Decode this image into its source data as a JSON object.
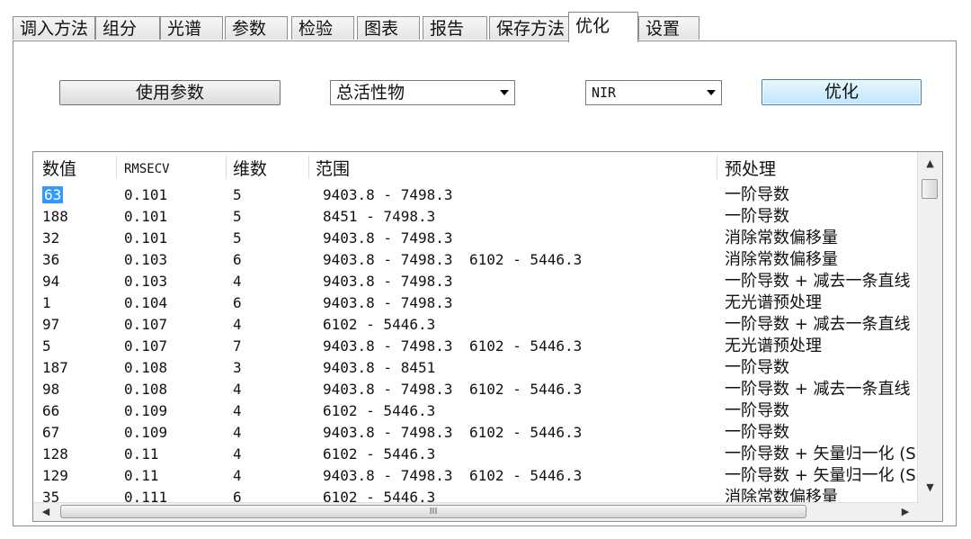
{
  "tabs": [
    "调入方法",
    "组分",
    "光谱",
    "参数",
    "检验",
    "图表",
    "报告",
    "保存方法",
    "优化",
    "设置"
  ],
  "active_tab": "优化",
  "toolbar": {
    "use_params_label": "使用参数",
    "property_select": "总活性物",
    "spectrum_select": "NIR",
    "optimize_label": "优化"
  },
  "table": {
    "headers": [
      "数值",
      "RMSECV",
      "维数",
      "范围",
      "预处理"
    ],
    "rows": [
      [
        "63",
        "0.101",
        "5",
        "9403.8 - 7498.3",
        "",
        "一阶导数"
      ],
      [
        "188",
        "0.101",
        "5",
        "8451 - 7498.3",
        "",
        "一阶导数"
      ],
      [
        "32",
        "0.101",
        "5",
        "9403.8 - 7498.3",
        "",
        "消除常数偏移量"
      ],
      [
        "36",
        "0.103",
        "6",
        "9403.8 - 7498.3",
        "6102 - 5446.3",
        "消除常数偏移量"
      ],
      [
        "94",
        "0.103",
        "4",
        "9403.8 - 7498.3",
        "",
        "一阶导数 + 减去一条直线"
      ],
      [
        "1",
        "0.104",
        "6",
        "9403.8 - 7498.3",
        "",
        "无光谱预处理"
      ],
      [
        "97",
        "0.107",
        "4",
        "6102 - 5446.3",
        "",
        "一阶导数 + 减去一条直线"
      ],
      [
        "5",
        "0.107",
        "7",
        "9403.8 - 7498.3",
        "6102 - 5446.3",
        "无光谱预处理"
      ],
      [
        "187",
        "0.108",
        "3",
        "9403.8 - 8451",
        "",
        "一阶导数"
      ],
      [
        "98",
        "0.108",
        "4",
        "9403.8 - 7498.3",
        "6102 - 5446.3",
        "一阶导数 + 减去一条直线"
      ],
      [
        "66",
        "0.109",
        "4",
        "6102 - 5446.3",
        "",
        "一阶导数"
      ],
      [
        "67",
        "0.109",
        "4",
        "9403.8 - 7498.3",
        "6102 - 5446.3",
        "一阶导数"
      ],
      [
        "128",
        "0.11",
        "4",
        "6102 - 5446.3",
        "",
        "一阶导数 + 矢量归一化 (S"
      ],
      [
        "129",
        "0.11",
        "4",
        "9403.8 - 7498.3",
        "6102 - 5446.3",
        "一阶导数 + 矢量归一化 (S"
      ],
      [
        "35",
        "0.111",
        "6",
        "6102 - 5446.3",
        "",
        "消除常数偏移量"
      ]
    ],
    "selected_value": "63"
  },
  "scroll": {
    "up_arrow": "▲",
    "down_arrow": "▼",
    "left_arrow": "◀",
    "right_arrow": "▶",
    "grip": "III"
  }
}
